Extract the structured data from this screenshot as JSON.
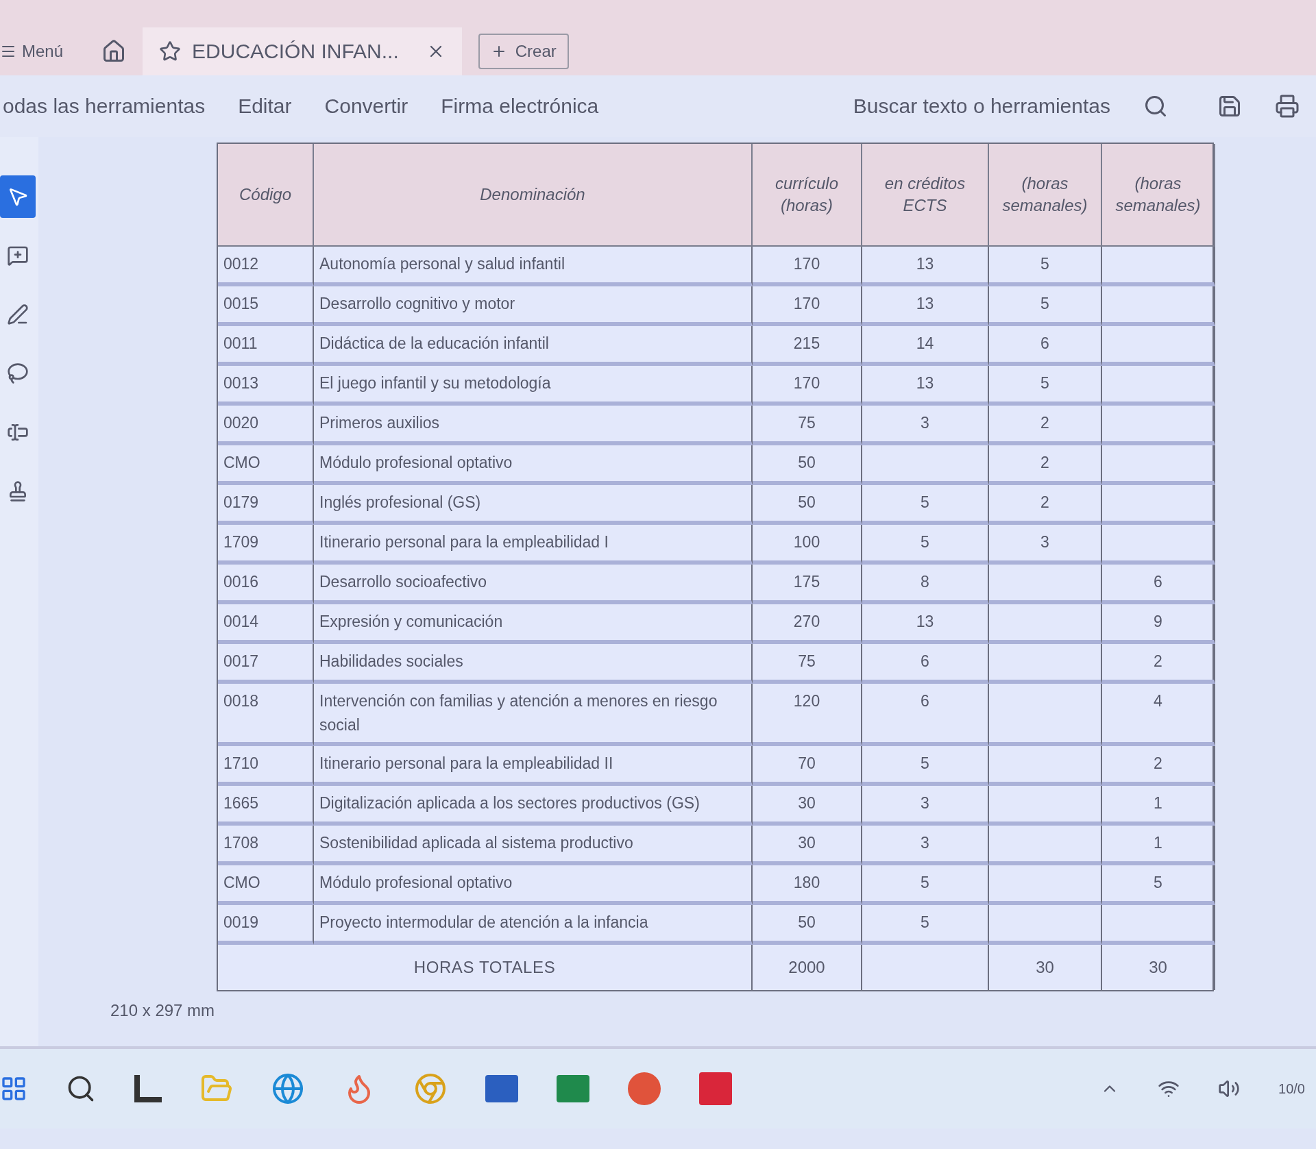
{
  "tab_bar": {
    "menu": "Menú",
    "tab": {
      "title": "EDUCACIÓN INFAN...",
      "selected": true
    },
    "create": "Crear"
  },
  "toolbar": {
    "items": [
      "odas las herramientas",
      "Editar",
      "Convertir",
      "Firma electrónica"
    ],
    "search": "Buscar texto o herramientas"
  },
  "tools": [
    {
      "kind": "select",
      "selected": true
    },
    {
      "kind": "comment",
      "selected": false
    },
    {
      "kind": "pen",
      "selected": false
    },
    {
      "kind": "lasso",
      "selected": false
    },
    {
      "kind": "text",
      "selected": false
    },
    {
      "kind": "stamp",
      "selected": false
    }
  ],
  "table": {
    "columns": [
      "Código",
      "Denominación",
      "currículo (horas)",
      "en créditos ECTS",
      "(horas semanales)",
      "(horas semanales)"
    ],
    "rows": [
      [
        "0012",
        "Autonomía personal y salud infantil",
        "170",
        "13",
        "5",
        null
      ],
      [
        "0015",
        "Desarrollo cognitivo y motor",
        "170",
        "13",
        "5",
        null
      ],
      [
        "0011",
        "Didáctica de la educación infantil",
        "215",
        "14",
        "6",
        null
      ],
      [
        "0013",
        "El juego infantil y su metodología",
        "170",
        "13",
        "5",
        null
      ],
      [
        "0020",
        "Primeros auxilios",
        "75",
        "3",
        "2",
        null
      ],
      [
        "CMO",
        "Módulo profesional optativo",
        "50",
        null,
        "2",
        null
      ],
      [
        "0179",
        "Inglés profesional (GS)",
        "50",
        "5",
        "2",
        null
      ],
      [
        "1709",
        "Itinerario personal para la empleabilidad I",
        "100",
        "5",
        "3",
        null
      ],
      [
        "0016",
        "Desarrollo socioafectivo",
        "175",
        "8",
        null,
        "6"
      ],
      [
        "0014",
        "Expresión y comunicación",
        "270",
        "13",
        null,
        "9"
      ],
      [
        "0017",
        "Habilidades sociales",
        "75",
        "6",
        null,
        "2"
      ],
      [
        "0018",
        "Intervención con familias y atención a menores en riesgo social",
        "120",
        "6",
        null,
        "4"
      ],
      [
        "1710",
        "Itinerario personal para la empleabilidad II",
        "70",
        "5",
        null,
        "2"
      ],
      [
        "1665",
        "Digitalización aplicada a los sectores productivos (GS)",
        "30",
        "3",
        null,
        "1"
      ],
      [
        "1708",
        "Sostenibilidad aplicada al sistema productivo",
        "30",
        "3",
        null,
        "1"
      ],
      [
        "CMO",
        "Módulo profesional optativo",
        "180",
        "5",
        null,
        "5"
      ],
      [
        "0019",
        "Proyecto intermodular de atención a la infancia",
        "50",
        "5",
        null,
        null
      ]
    ],
    "total": {
      "label": "HORAS TOTALES",
      "hours": "2000",
      "weekly": [
        "30",
        "30"
      ]
    }
  },
  "page_size": "210 x 297 mm",
  "taskbar": {
    "clock": "10/0"
  }
}
